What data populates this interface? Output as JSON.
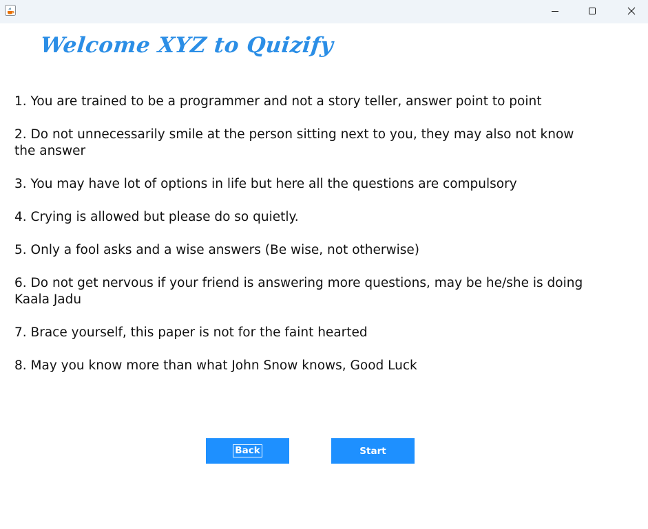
{
  "titlebar": {
    "app_icon": "java-cup-icon",
    "minimize_icon": "minimize-icon",
    "maximize_icon": "maximize-icon",
    "close_icon": "close-icon"
  },
  "heading": "Welcome XYZ to Quizify",
  "rules": [
    "1. You are trained to be a programmer and not a story teller, answer point to point",
    "2. Do not unnecessarily smile at the person sitting next to you, they may also not know the answer",
    "3. You may have lot of options in life but here all the questions are compulsory",
    "4. Crying is allowed but please do so quietly.",
    "5. Only a fool asks and a wise answers (Be wise, not otherwise)",
    "6. Do not get nervous if your friend is answering more questions, may be he/she is doing Kaala Jadu",
    "7. Brace yourself, this paper is not for the faint hearted",
    "8. May you know more than what John Snow knows, Good Luck"
  ],
  "buttons": {
    "back_label": "Back",
    "start_label": "Start"
  },
  "colors": {
    "heading": "#2b8ee6",
    "button_bg": "#1e90ff",
    "button_text": "#ffffff",
    "titlebar_bg": "#eff4f9"
  }
}
